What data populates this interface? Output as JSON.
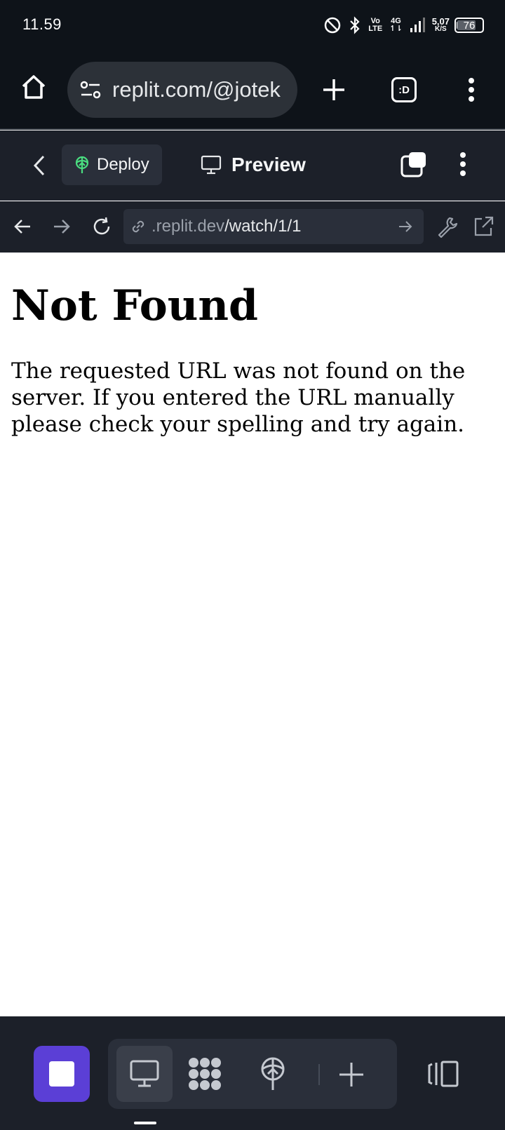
{
  "status_bar": {
    "time": "11.59",
    "volte_top": "Vo",
    "volte_bottom": "LTE",
    "network_top": "4G",
    "network_bottom": "↿⇂",
    "speed_value": "5,07",
    "speed_unit": "K/S",
    "battery": "76",
    "battery_level": 0.76
  },
  "browser": {
    "url": "replit.com/@jotek",
    "tab_count_label": ":D"
  },
  "replit_toolbar": {
    "deploy_label": "Deploy",
    "preview_label": "Preview"
  },
  "webview": {
    "url_domain": ".replit.dev",
    "url_path": "/watch/1/1"
  },
  "page": {
    "heading": "Not Found",
    "message": "The requested URL was not found on the server. If you entered the URL manually please check your spelling and try again."
  },
  "colors": {
    "status_bg": "#0e1319",
    "toolbar_bg": "#1c2029",
    "accent": "#5b3fd6",
    "deploy_icon": "#4ade80"
  },
  "icons": {
    "home": "home-icon",
    "tune": "site-settings-icon",
    "new_tab": "plus-icon",
    "menu": "more-vert-icon",
    "back": "chevron-left-icon",
    "deploy": "deploy-icon",
    "preview": "monitor-icon",
    "tabs_switcher": "tabs-icon",
    "nav_back": "arrow-left-icon",
    "nav_forward": "arrow-right-icon",
    "reload": "reload-icon",
    "link": "link-icon",
    "go": "arrow-right-icon",
    "devtools": "wrench-icon",
    "open_external": "external-link-icon",
    "stop": "stop-icon",
    "console": "monitor-icon",
    "workflow": "workflows-icon",
    "deploy_tool": "deploy-icon",
    "add_tool": "plus-icon",
    "layout": "layout-icon"
  }
}
